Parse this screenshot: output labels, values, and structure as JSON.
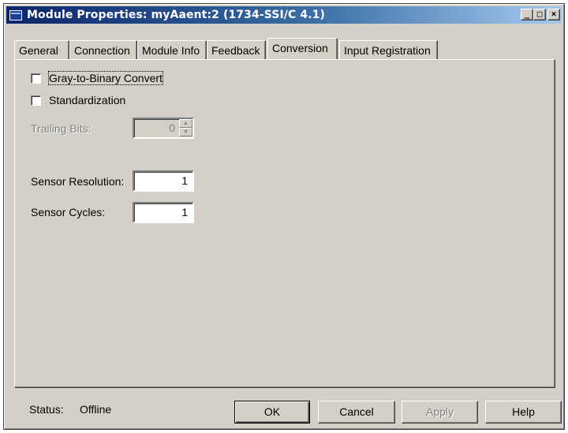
{
  "window": {
    "title": "Module Properties: myAaent:2 (1734-SSI/C 4.1)",
    "controls": {
      "minimize": "_",
      "maximize": "□",
      "close": "×"
    }
  },
  "tabs": [
    {
      "label": "General",
      "active": false
    },
    {
      "label": "Connection",
      "active": false
    },
    {
      "label": "Module Info",
      "active": false
    },
    {
      "label": "Feedback",
      "active": false
    },
    {
      "label": "Conversion",
      "active": true
    },
    {
      "label": "Input Registration",
      "active": false
    }
  ],
  "conversion": {
    "gray_to_binary": {
      "label": "Gray-to-Binary Convert",
      "checked": false
    },
    "standardization": {
      "label": "Standardization",
      "checked": false
    },
    "trailing_bits": {
      "label": "Trailing Bits:",
      "value": "0",
      "enabled": false
    },
    "sensor_resolution": {
      "label": "Sensor Resolution:",
      "value": "1"
    },
    "sensor_cycles": {
      "label": "Sensor Cycles:",
      "value": "1"
    }
  },
  "footer": {
    "status_label": "Status:",
    "status_value": "Offline",
    "ok": "OK",
    "cancel": "Cancel",
    "apply": "Apply",
    "help": "Help"
  },
  "colors": {
    "face": "#d4d0c8",
    "title_start": "#0a246a",
    "title_end": "#a6caf0",
    "disabled_text": "#808080"
  }
}
